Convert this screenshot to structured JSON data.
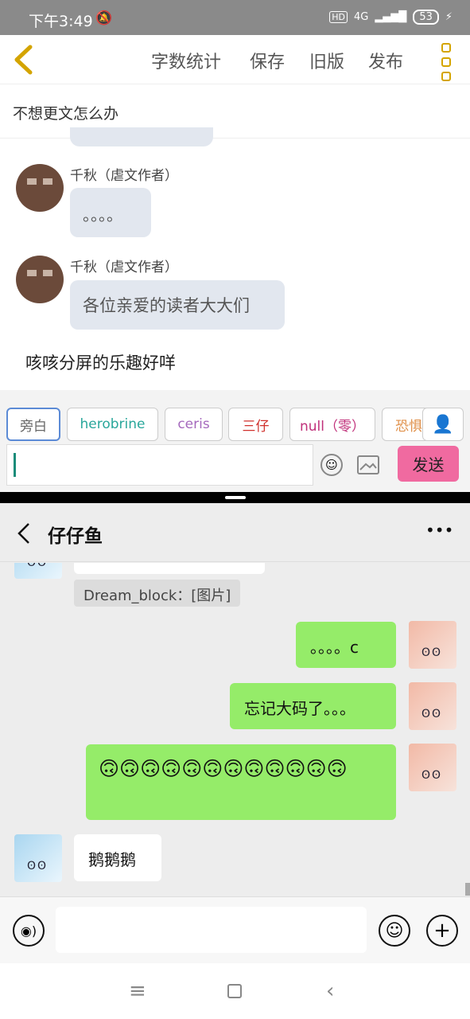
{
  "status": {
    "time": "下午3:49",
    "hd": "HD",
    "signal": "4G",
    "battery": "53"
  },
  "editor_header": {
    "word_count": "字数统计",
    "save": "保存",
    "old_version": "旧版",
    "publish": "发布"
  },
  "chapter_title": "不想更文怎么办",
  "upper_chat": {
    "author_name": "千秋（虐文作者）",
    "messages": [
      {
        "name": "千秋（虐文作者）",
        "text": "。。。。"
      },
      {
        "name": "千秋（虐文作者）",
        "text": "各位亲爱的读者大大们"
      }
    ],
    "narration": "咳咳分屏的乐趣好咩"
  },
  "roles": [
    "旁白",
    "herobrine",
    "ceris",
    "三仔",
    "null（零）",
    "恐惧"
  ],
  "role_colors": [
    "#666666",
    "#2aa79b",
    "#a569bd",
    "#d0312d",
    "#c0307a",
    "#e0904a"
  ],
  "send_label": "发送",
  "lower_chat": {
    "title": "仔仔鱼",
    "more": "•••",
    "system_note": "Dream_block：[图片]",
    "messages": [
      {
        "side": "right",
        "text": "。。。。c"
      },
      {
        "side": "right",
        "text": "忘记大码了。。。"
      },
      {
        "side": "right",
        "text": "🙃🙃🙃🙃🙃🙃🙃🙃🙃🙃🙃🙃"
      },
      {
        "side": "left",
        "text": "鹅鹅鹅"
      }
    ]
  }
}
